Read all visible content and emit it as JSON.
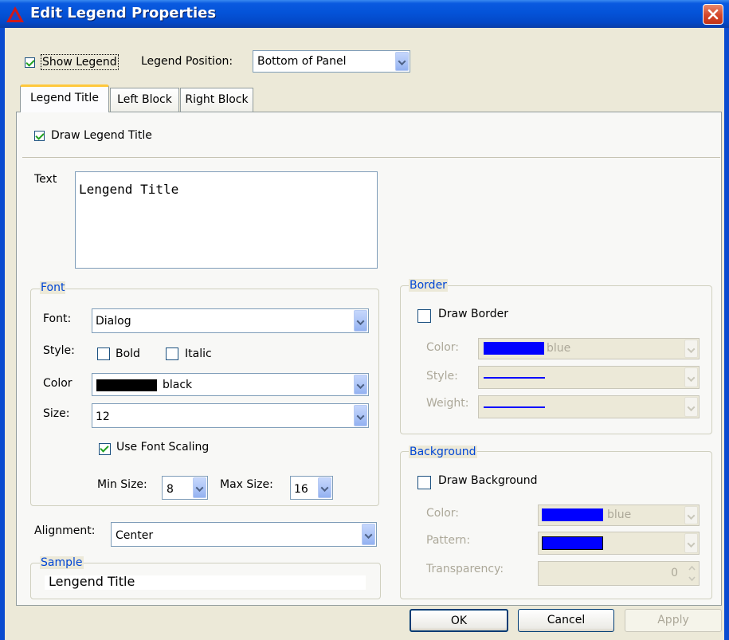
{
  "window": {
    "title": "Edit Legend Properties",
    "icon": "app-triangle-icon",
    "close_icon": "close-icon"
  },
  "top": {
    "show_legend": {
      "label": "Show Legend",
      "checked": true
    },
    "legend_position": {
      "label": "Legend Position:",
      "value": "Bottom of Panel"
    }
  },
  "tabs": [
    {
      "label": "Legend Title",
      "active": true
    },
    {
      "label": "Left Block",
      "active": false
    },
    {
      "label": "Right Block",
      "active": false
    }
  ],
  "legend_title": {
    "draw_title": {
      "label": "Draw Legend Title",
      "checked": true
    },
    "text_label": "Text",
    "text_value": "Lengend Title",
    "font_group": {
      "title": "Font",
      "font_label": "Font:",
      "font_value": "Dialog",
      "style_label": "Style:",
      "bold": {
        "label": "Bold",
        "checked": false
      },
      "italic": {
        "label": "Italic",
        "checked": false
      },
      "color_label": "Color",
      "color_value": "black",
      "color_hex": "#000000",
      "size_label": "Size:",
      "size_value": "12",
      "use_scaling": {
        "label": "Use Font Scaling",
        "checked": true
      },
      "min_size_label": "Min Size:",
      "min_size_value": "8",
      "max_size_label": "Max Size:",
      "max_size_value": "16"
    },
    "alignment_label": "Alignment:",
    "alignment_value": "Center",
    "sample_group": {
      "title": "Sample",
      "text": "Lengend Title"
    },
    "border_group": {
      "title": "Border",
      "draw_border": {
        "label": "Draw Border",
        "checked": false
      },
      "color_label": "Color:",
      "color_value": "blue",
      "color_hex": "#0000ff",
      "style_label": "Style:",
      "weight_label": "Weight:"
    },
    "background_group": {
      "title": "Background",
      "draw_background": {
        "label": "Draw Background",
        "checked": false
      },
      "color_label": "Color:",
      "color_value": "blue",
      "color_hex": "#0000ff",
      "pattern_label": "Pattern:",
      "transparency_label": "Transparency:",
      "transparency_value": "0"
    }
  },
  "buttons": {
    "ok": "OK",
    "cancel": "Cancel",
    "apply": "Apply"
  }
}
